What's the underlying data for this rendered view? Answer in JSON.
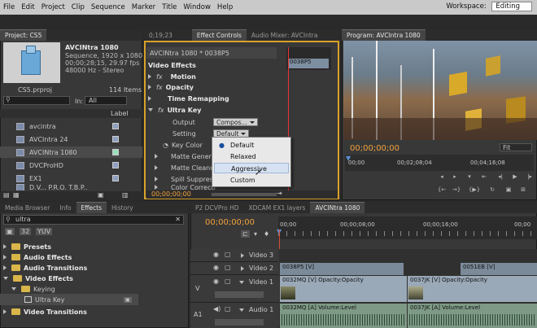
{
  "menu": [
    "File",
    "Edit",
    "Project",
    "Clip",
    "Sequence",
    "Marker",
    "Title",
    "Window",
    "Help"
  ],
  "workspace": {
    "label": "Workspace:",
    "value": "Editing"
  },
  "project": {
    "tab": "Project: CS5",
    "clip_name": "AVCINtra 1080",
    "clip_info1": "Sequence, 1920 x 1080",
    "clip_info2": "00;00;28;15, 29.97 fps",
    "clip_info3": "48000 Hz - Stereo",
    "file": "CS5.prproj",
    "items_count": "114 Items",
    "in_label": "In:",
    "in_value": "All",
    "label_header": "Label",
    "items": [
      "avcintra",
      "AVCIntra 24",
      "AVCINtra 1080",
      "DVCProHD",
      "EX1"
    ],
    "last_item": "D.V...  P.R.O.  T.B.P.."
  },
  "source_tab": "0;19;23",
  "effect_controls": {
    "tab": "Effect Controls",
    "tab2": "Audio Mixer: AVCIntra",
    "header": "AVCINtra 1080 * 0038P5",
    "timeline_clip": "0038P5",
    "video_effects": "Video Effects",
    "motion": "Motion",
    "opacity": "Opacity",
    "time_remap": "Time Remapping",
    "ultra_key": "Ultra Key",
    "output_label": "Output",
    "output_value": "Compos...",
    "setting_label": "Setting",
    "setting_value": "Default",
    "key_color": "Key Color",
    "matte_gen": "Matte Generat",
    "matte_clean": "Matte Cleanup",
    "spill": "Spill Suppress",
    "color_corr": "Color Correcti",
    "timecode": "00;00;00;00",
    "fx": "fx"
  },
  "dropdown_menu": [
    "Default",
    "Relaxed",
    "Aggressive",
    "Custom"
  ],
  "program": {
    "tab": "Program: AVCIntra 1080",
    "timecode": "00;00;00;00",
    "fit": "Fit",
    "ruler": [
      "00;00",
      "00;02;08;04",
      "00;04;16;08"
    ]
  },
  "effects_panel": {
    "tabs": [
      "Media Browser",
      "Info",
      "Effects",
      "History"
    ],
    "search": "ultra",
    "items": [
      "Presets",
      "Audio Effects",
      "Audio Transitions",
      "Video Effects",
      "Keying",
      "Ultra Key",
      "Video Transitions"
    ]
  },
  "timeline": {
    "tabs": [
      "P2 DCVPro HD",
      "XDCAM EX1 layers",
      "AVCINtra 1080"
    ],
    "timecode": "00;00;00;00",
    "ruler": [
      "00;00",
      "00;00;08;00",
      "00;00;16;00",
      "00;00"
    ],
    "tracks": [
      "Video 3",
      "Video 2",
      "Video 1",
      "Audio 1"
    ],
    "v_label": "V",
    "a1_label": "A1",
    "clips": {
      "v2a": "0038P5 [V]",
      "v2b": "0051EB [V]",
      "v1a": "0032MQ [V]  Opacity:Opacity",
      "v1b": "0037JK [V]  Opacity:Opacity",
      "a1a": "0032MQ [A]  Volume:Level",
      "a1b": "0037JK [A]  Volume:Level"
    }
  }
}
